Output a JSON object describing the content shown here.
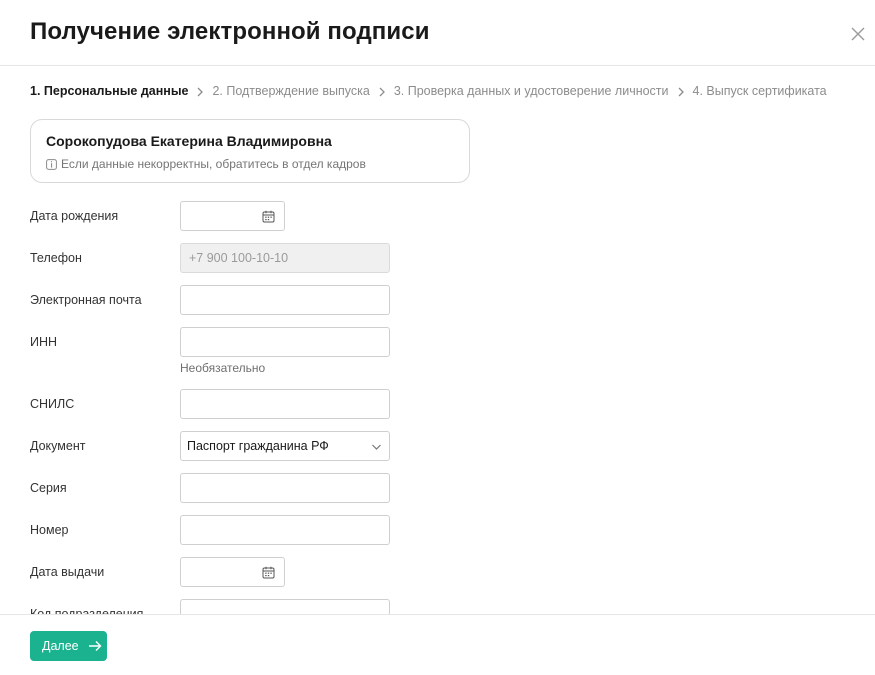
{
  "dialog": {
    "title": "Получение электронной подписи"
  },
  "steps": [
    {
      "label": "1. Персональные данные",
      "active": true
    },
    {
      "label": "2. Подтверждение выпуска",
      "active": false
    },
    {
      "label": "3. Проверка данных и удостоверение личности",
      "active": false
    },
    {
      "label": "4. Выпуск сертификата",
      "active": false
    }
  ],
  "person": {
    "name": "Сорокопудова Екатерина Владимировна",
    "hint": "Если данные некорректны, обратитесь в отдел кадров"
  },
  "form": {
    "birth_date": {
      "label": "Дата рождения",
      "value": ""
    },
    "phone": {
      "label": "Телефон",
      "value": "+7 900 100-10-10"
    },
    "email": {
      "label": "Электронная почта",
      "value": ""
    },
    "inn": {
      "label": "ИНН",
      "value": "",
      "hint": "Необязательно"
    },
    "snils": {
      "label": "СНИЛС",
      "value": ""
    },
    "document": {
      "label": "Документ",
      "value": "Паспорт гражданина РФ"
    },
    "series": {
      "label": "Серия",
      "value": ""
    },
    "number": {
      "label": "Номер",
      "value": ""
    },
    "issue_date": {
      "label": "Дата выдачи",
      "value": ""
    },
    "division_code": {
      "label": "Код подразделения",
      "value": ""
    }
  },
  "footer": {
    "next_label": "Далее"
  },
  "colors": {
    "accent": "#1bb28f",
    "border": "#cfcfcf",
    "disabled_bg": "#f0f0f0"
  },
  "icons": {
    "close": "close-icon",
    "step_separator": "chevron-right-icon",
    "info": "info-icon",
    "calendar": "calendar-icon",
    "dropdown": "chevron-down-icon",
    "next": "arrow-right-icon"
  }
}
